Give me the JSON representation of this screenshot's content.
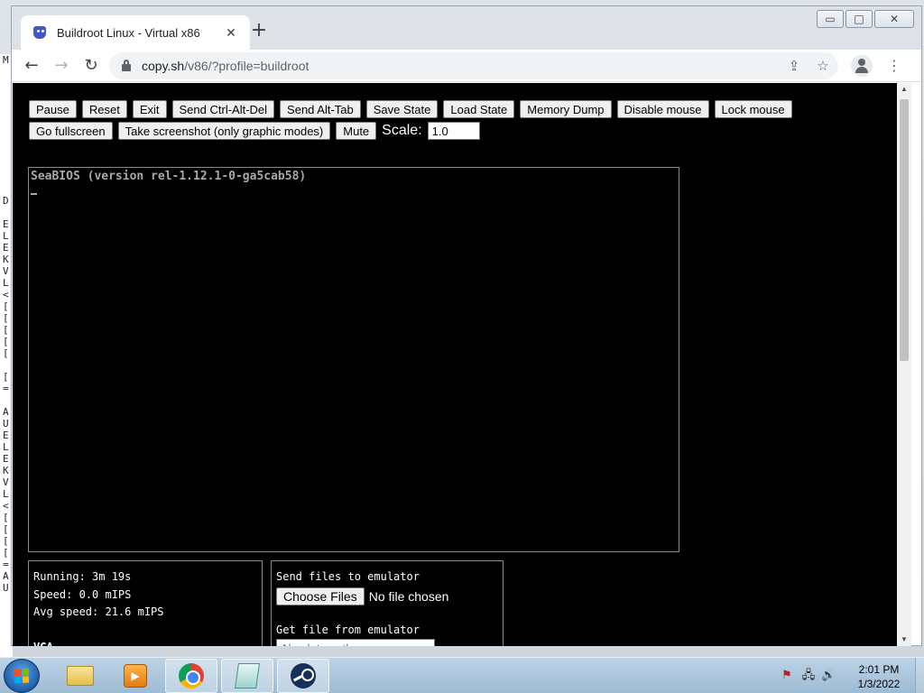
{
  "browser": {
    "tab_title": "Buildroot Linux - Virtual x86",
    "tab_close": "✕",
    "new_tab": "+",
    "url_host": "copy.sh",
    "url_path": "/v86/?profile=buildroot",
    "window_controls": {
      "minimize": "▭",
      "maximize": "□",
      "close": "✕"
    }
  },
  "toolbar_row1": [
    "Pause",
    "Reset",
    "Exit",
    "Send Ctrl-Alt-Del",
    "Send Alt-Tab",
    "Save State",
    "Load State",
    "Memory Dump",
    "Disable mouse",
    "Lock mouse"
  ],
  "toolbar_row2": [
    "Go fullscreen",
    "Take screenshot (only graphic modes)",
    "Mute"
  ],
  "scale": {
    "label": "Scale:",
    "value": "1.0"
  },
  "screen": {
    "line1": "SeaBIOS (version rel-1.12.1-0-ga5cab58)"
  },
  "stats": {
    "running": "Running: 3m 19s",
    "speed": "Speed: 0.0 mIPS",
    "avg_speed": "Avg speed: 21.6 mIPS",
    "vga": "VGA"
  },
  "files": {
    "send_title": "Send files to emulator",
    "choose_button": "Choose Files",
    "no_file": "No file chosen",
    "get_title": "Get file from emulator",
    "path_placeholder": "Absolute path"
  },
  "desktop_strip": "M\n\n\n\n\n\n\n\n\n\n\n\nD\n\nE\nL\nE\nK\nV\nL\n<\n[\n[\n[\n[\n[\n\n[\n=\n\nA\nU\nE\nL\nE\nK\nV\nL\n<\n[\n[\n[\n[\n=\nA\nU",
  "taskbar": {
    "time": "2:01 PM",
    "date": "1/3/2022"
  },
  "colors": {
    "page_bg": "#000000",
    "tab_strip": "#dee1e6",
    "taskbar": "#a9c4da"
  }
}
